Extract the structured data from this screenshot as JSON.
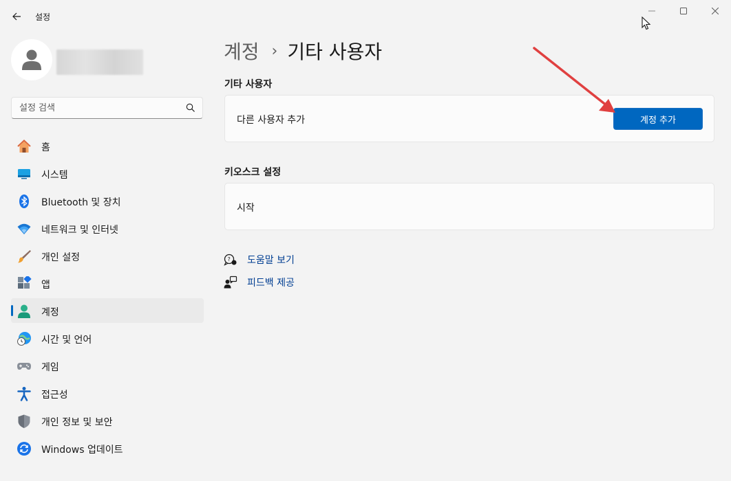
{
  "window": {
    "title": "설정"
  },
  "search": {
    "placeholder": "설정 검색"
  },
  "nav": {
    "items": [
      {
        "label": "홈",
        "icon": "home-icon"
      },
      {
        "label": "시스템",
        "icon": "system-icon"
      },
      {
        "label": "Bluetooth 및 장치",
        "icon": "bluetooth-icon"
      },
      {
        "label": "네트워크 및 인터넷",
        "icon": "wifi-icon"
      },
      {
        "label": "개인 설정",
        "icon": "brush-icon"
      },
      {
        "label": "앱",
        "icon": "apps-icon"
      },
      {
        "label": "계정",
        "icon": "account-icon",
        "active": true
      },
      {
        "label": "시간 및 언어",
        "icon": "time-language-icon"
      },
      {
        "label": "게임",
        "icon": "gamepad-icon"
      },
      {
        "label": "접근성",
        "icon": "accessibility-icon"
      },
      {
        "label": "개인 정보 및 보안",
        "icon": "shield-icon"
      },
      {
        "label": "Windows 업데이트",
        "icon": "update-icon"
      }
    ]
  },
  "breadcrumb": {
    "parent": "계정",
    "separator": "›",
    "current": "기타 사용자"
  },
  "sections": {
    "other_users": {
      "title": "기타 사용자",
      "row_label": "다른 사용자 추가",
      "button_label": "계정 추가"
    },
    "kiosk": {
      "title": "키오스크 설정",
      "row_label": "시작"
    }
  },
  "links": {
    "help": "도움말 보기",
    "feedback": "피드백 제공"
  },
  "colors": {
    "accent": "#0067c0",
    "annotation_arrow": "#e04040",
    "link": "#003e92"
  }
}
